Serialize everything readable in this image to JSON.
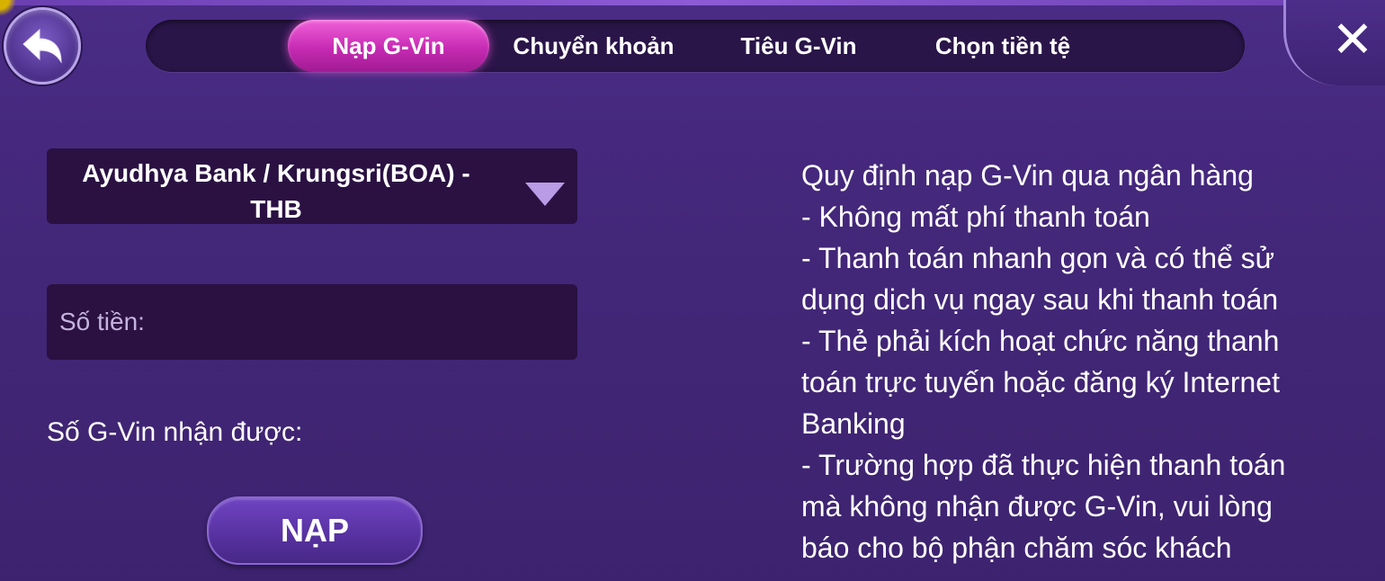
{
  "tabs": [
    {
      "label": "Nạp G-Vin",
      "active": true
    },
    {
      "label": "Chuyển khoản",
      "active": false
    },
    {
      "label": "Tiêu G-Vin",
      "active": false
    },
    {
      "label": "Chọn tiền tệ",
      "active": false
    }
  ],
  "icons": {
    "back": "back-arrow-icon",
    "close": "close-icon",
    "dropdown": "triangle-down-icon"
  },
  "close_glyph": "✕",
  "deposit_form": {
    "bank_selected_line1": "Ayudhya Bank / Krungsri(BOA) -",
    "bank_selected_line2": "THB",
    "amount_placeholder": "Số tiền:",
    "amount_value": "",
    "received_label": "Số G-Vin nhận được:",
    "submit_label": "NẠP"
  },
  "rules_lines": [
    "Quy định nạp G-Vin qua ngân hàng",
    "- Không mất phí thanh toán",
    "- Thanh toán nhanh gọn và có thể sử",
    "dụng dịch vụ ngay sau khi thanh toán",
    "- Thẻ phải kích hoạt chức năng thanh",
    "toán trực tuyến hoặc đăng ký Internet",
    "Banking",
    "- Trường hợp đã thực hiện thanh toán",
    "mà không nhận được G-Vin, vui lòng",
    "báo cho bộ phận chăm sóc khách"
  ],
  "colors": {
    "background": "#432779",
    "active_tab": "#c62bb3",
    "field_bg": "#2a1142",
    "tab_bar_bg": "#2a1548",
    "button": "#56319f"
  }
}
